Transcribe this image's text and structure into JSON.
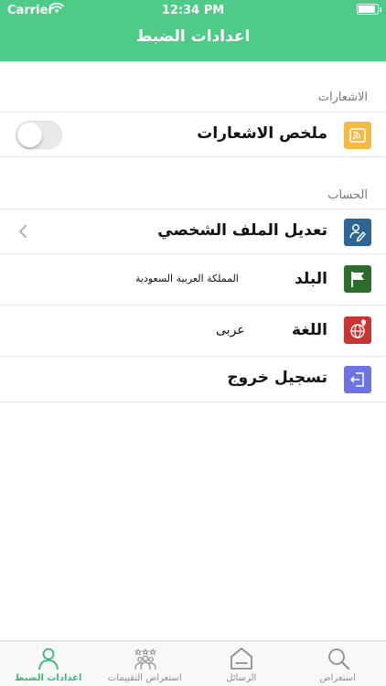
{
  "status_bar": {
    "carrier": "Carrier",
    "time": "12:34 PM",
    "battery_level": 0.95
  },
  "navigation": {
    "title": "اعدادات الضبط"
  },
  "colors": {
    "header_green": "#4ecb86",
    "active_tab_green": "#37b878",
    "notifications_icon": "#f4b843",
    "profile_icon": "#2d6694",
    "country_icon": "#2c6c2c",
    "language_icon": "#cc3434",
    "logout_icon": "#6b74e0"
  },
  "sections": {
    "notifications": {
      "header": "الاشعارات",
      "summary": {
        "label": "ملخص الاشعارات",
        "icon": "rss-icon",
        "toggle_on": false
      }
    },
    "account": {
      "header": "الحساب",
      "profile": {
        "label": "تعديل الملف الشخصي",
        "icon": "edit-profile-icon"
      },
      "country": {
        "label": "البلد",
        "value": "المملكة العربية السعودية",
        "icon": "flag-icon"
      },
      "language": {
        "label": "اللغة",
        "value": "عربى",
        "icon": "globe-icon"
      },
      "logout": {
        "label": "تسجيل خروج",
        "icon": "logout-icon"
      }
    }
  },
  "tab_bar": {
    "tabs": [
      {
        "label": "اعدادات الضبط",
        "icon": "person-icon",
        "active": true
      },
      {
        "label": "استعراض التقييمات",
        "icon": "group-rating-icon",
        "active": false
      },
      {
        "label": "الرسائل",
        "icon": "home-icon",
        "active": false
      },
      {
        "label": "استعراض",
        "icon": "search-icon",
        "active": false
      }
    ]
  }
}
